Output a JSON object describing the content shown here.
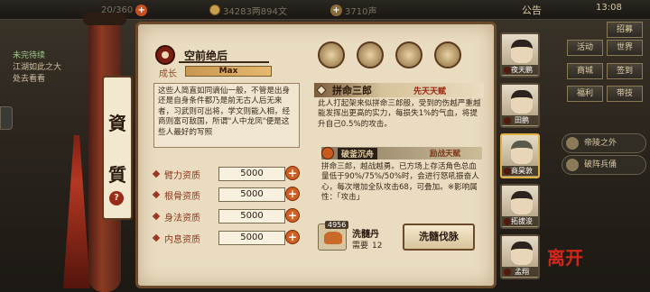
{
  "topbar": {
    "stamina": "20/360",
    "coins": "34283两894文",
    "fame": "3710声",
    "notice": "公告",
    "time": "13:08"
  },
  "left_panel": {
    "quest_title": "未完待续",
    "quest_line1": "江湖如此之大",
    "quest_line2": "处去看看"
  },
  "side_tab": {
    "char1": "資",
    "char2": "質",
    "help": "?"
  },
  "hero": {
    "title": "空前绝后",
    "growth_label": "成长",
    "growth_value": "Max",
    "description": "这些人简直如同谪仙一般，不管是出身还是自身条件都乃是前无古人后无来者，习武则可出将，学文则能入相，经商则富可敌国，所谓\"人中龙凤\"便是这些人最好的写照"
  },
  "attributes": [
    {
      "label": "臂力资质",
      "value": "5000"
    },
    {
      "label": "根骨资质",
      "value": "5000"
    },
    {
      "label": "身法资质",
      "value": "5000"
    },
    {
      "label": "内息资质",
      "value": "5000"
    }
  ],
  "talent": {
    "name": "拼命三郎",
    "tag": "先天天赋",
    "description": "此人打起架来似拼命三郎般，受到的伤越严重越能发挥出更高的实力，每损失1%的气血，将提升自己0.5%的攻击。"
  },
  "sub_talent": {
    "name": "破釜沉舟",
    "tag": "励战天赋",
    "description": "拼命三郎，越战越勇。已方场上存活角色总血量低于90%/75%/50%时，会进行怒吼振奋人心，每次增加全队攻击68，可叠加。※影响属性：「攻击」"
  },
  "item": {
    "count": "4956",
    "name": "洗髓丹",
    "need_label": "需要",
    "need_value": "12",
    "button": "洗髓伐脉"
  },
  "roster": [
    {
      "name": "夜天鹏"
    },
    {
      "name": "田鹏"
    },
    {
      "name": "商昊敦"
    },
    {
      "name": "拓拔浚"
    },
    {
      "name": "孟翔"
    }
  ],
  "right_menu": {
    "btn1": "招募",
    "btn2": "活动",
    "btn3": "商城",
    "btn4": "签到",
    "btn5": "福利",
    "btn6": "带技",
    "btn7": "世界",
    "pill1": "帝陵之外",
    "pill2": "破阵兵俑"
  },
  "close_label": "离开"
}
